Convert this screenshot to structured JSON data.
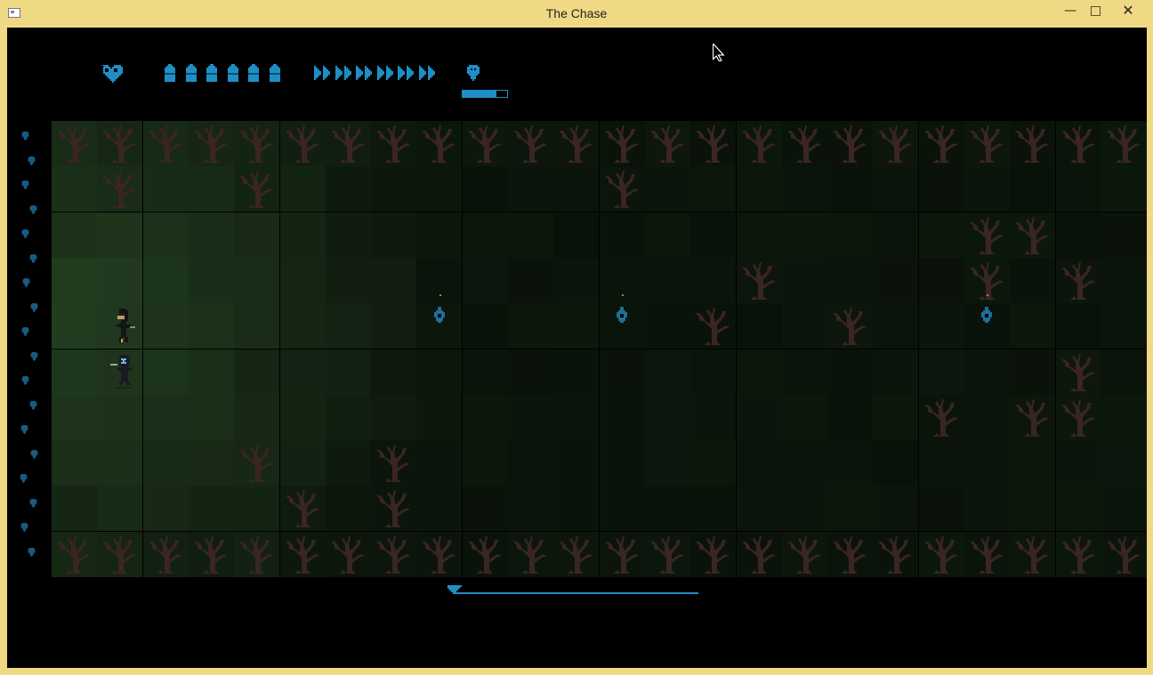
{
  "window": {
    "title": "The Chase",
    "minimize_icon": "minimize-icon",
    "maximize_icon": "maximize-icon",
    "close_icon": "close-icon"
  },
  "colors": {
    "hud_blue": "#1e8fc6",
    "titlebar": "#f0d984",
    "background": "#000000",
    "tree": "#3a2523"
  },
  "hud": {
    "health_icon": "heart-icon",
    "ammo_icon": "bullet-icon",
    "ammo_count": 6,
    "speed_icon": "fast-forward-icon",
    "speed_count": 6,
    "enemy_icon": "skull-icon",
    "enemy_meter_fraction": 0.75
  },
  "level": {
    "progress_fraction": 0.0
  }
}
